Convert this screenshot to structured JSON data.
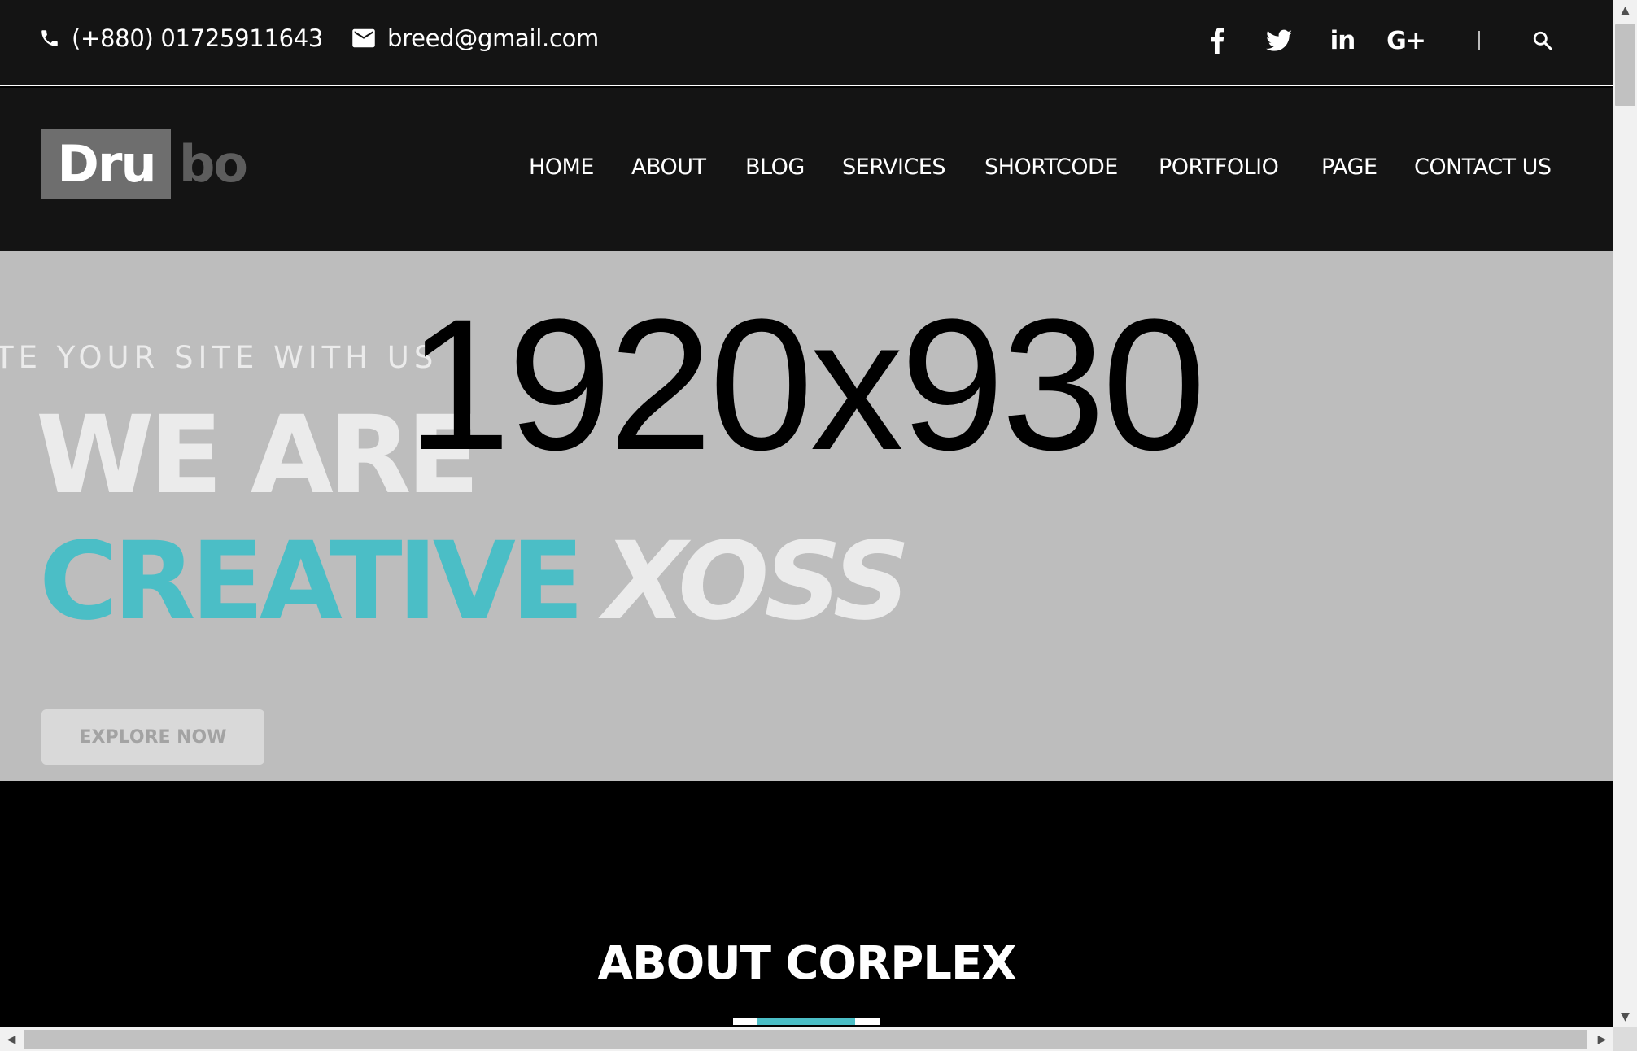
{
  "topbar": {
    "phone": "(+880) 01725911643",
    "email": "breed@gmail.com",
    "icons": {
      "phone": "phone-icon",
      "email": "envelope-icon",
      "facebook": "facebook-icon",
      "twitter": "twitter-icon",
      "linkedin": "linkedin-icon",
      "googleplus": "google-plus-icon",
      "search": "search-icon"
    },
    "linkedin_glyph": "in",
    "googleplus_glyph": "G+"
  },
  "header": {
    "logo_box": "Dru",
    "logo_rest": "bo",
    "nav": [
      "HOME",
      "ABOUT",
      "BLOG",
      "SERVICES",
      "SHORTCODE",
      "PORTFOLIO",
      "PAGE",
      "CONTACT US"
    ]
  },
  "hero": {
    "tagline": "TE YOUR SITE WITH US",
    "line1": "WE ARE",
    "line2_accent": "CREATIVE",
    "line2_rest": "XOSS",
    "placeholder_label": "1920x930",
    "button": "EXPLORE NOW"
  },
  "about": {
    "title": "ABOUT CORPLEX"
  },
  "colors": {
    "accent": "#4bbec6",
    "topbar_bg": "#141414",
    "hero_bg": "#bdbdbd",
    "hero_text": "#ebebeb"
  },
  "scrollbars": {
    "up_arrow": "▲",
    "down_arrow": "▼",
    "left_arrow": "◀",
    "right_arrow": "▶"
  }
}
